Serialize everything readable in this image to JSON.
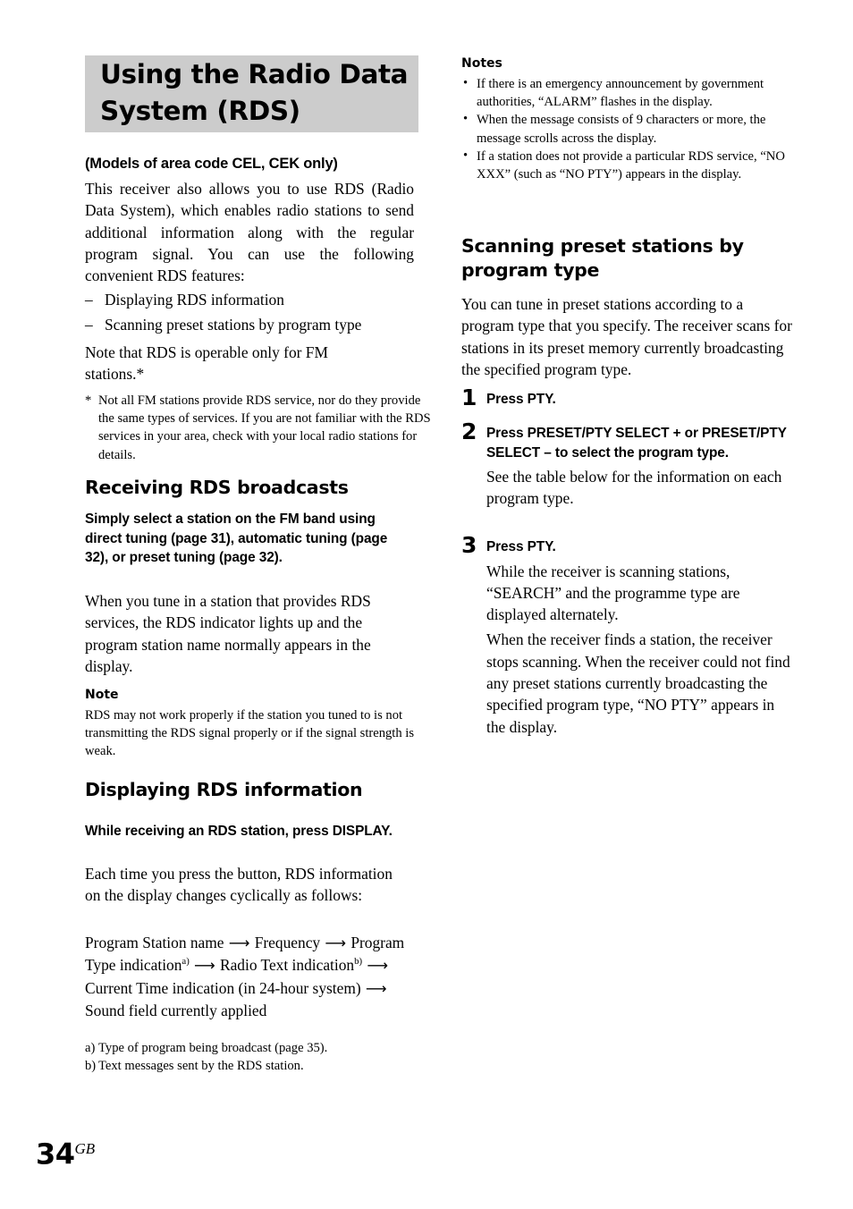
{
  "page": {
    "folio_number": "34",
    "folio_suffix": "GB",
    "banner_bg": "#cccccc"
  },
  "banner": {
    "title": "Using the Radio Data\nSystem (RDS)"
  },
  "left_column": {
    "models_note": "(Models of area code CEL, CEK only)",
    "intro": "This receiver also allows you to use RDS (Radio Data System), which enables radio stations to send additional information along with the regular program signal.  You can use the following convenient RDS features:",
    "feature_list": [
      {
        "marker": "–",
        "text": "Displaying RDS information"
      },
      {
        "marker": "–",
        "text": "Scanning preset stations by program type"
      }
    ],
    "fm_note": "Note that RDS is operable only for FM stations.*",
    "asterisk_footnote_marker": "*",
    "asterisk_footnote": "Not all FM stations provide RDS service, nor do they provide the same types of services.  If you are not familiar with the RDS services in your area, check with your local radio stations for details.",
    "heading_receiving": "Receiving RDS broadcasts",
    "receiving_lead": "Simply select a station on the FM band using direct tuning (page 31), automatic tuning (page 32), or preset tuning (page 32).",
    "receiving_body": "When you tune in a station that provides RDS services, the RDS indicator lights up and the program station name normally appears in the display.",
    "note_label": "Note",
    "note_body": "RDS may not work properly if the station you tuned to is not transmitting the RDS signal properly or if the signal strength is weak.",
    "heading_displaying": "Displaying RDS information",
    "displaying_lead": "While receiving an RDS station, press DISPLAY.",
    "displaying_body": "Each time you press the button, RDS information on the display changes cyclically as follows:",
    "cycle_sequence": {
      "arrow": "⟶",
      "items": [
        {
          "label": "Program Station name",
          "sup": ""
        },
        {
          "label": "Frequency",
          "sup": ""
        },
        {
          "label": "Program Type indication",
          "sup": "a)"
        },
        {
          "label": "Radio Text indication",
          "sup": "b)"
        },
        {
          "label": "Current Time indication (in 24-hour system)",
          "sup": ""
        },
        {
          "label": "Sound field currently applied",
          "sup": ""
        }
      ]
    },
    "footnotes": [
      {
        "marker": "a)",
        "text": "Type of program being broadcast (page 35)."
      },
      {
        "marker": "b)",
        "text": "Text messages sent by the RDS station."
      }
    ]
  },
  "right_column": {
    "notes_label": "Notes",
    "notes": [
      {
        "marker": "•",
        "text": "If there is an emergency announcement by government authorities, “ALARM” flashes in the display."
      },
      {
        "marker": "•",
        "text": "When the message consists of 9 characters or more, the message scrolls across the display."
      },
      {
        "marker": "•",
        "text": "If a station does not provide a particular RDS service, “NO XXX” (such as “NO PTY”) appears in the display."
      }
    ],
    "heading_scanning": "Scanning preset stations by program type",
    "scanning_body": "You can tune in preset stations according to a program type that you specify.  The receiver scans for stations in its preset memory currently broadcasting the specified program type.",
    "steps": [
      {
        "number": "1",
        "title": "Press PTY.",
        "paragraphs": []
      },
      {
        "number": "2",
        "title": "Press PRESET/PTY SELECT + or PRESET/PTY SELECT – to select the program type.",
        "paragraphs": [
          "See the table below for the information on each program type."
        ]
      },
      {
        "number": "3",
        "title": "Press PTY.",
        "paragraphs": [
          "While the receiver is scanning stations, “SEARCH” and the programme type are displayed alternately.",
          "When the receiver finds a station, the receiver stops scanning. When the receiver could not find any preset stations currently broadcasting the specified program type, “NO PTY” appears in the display."
        ]
      }
    ]
  }
}
